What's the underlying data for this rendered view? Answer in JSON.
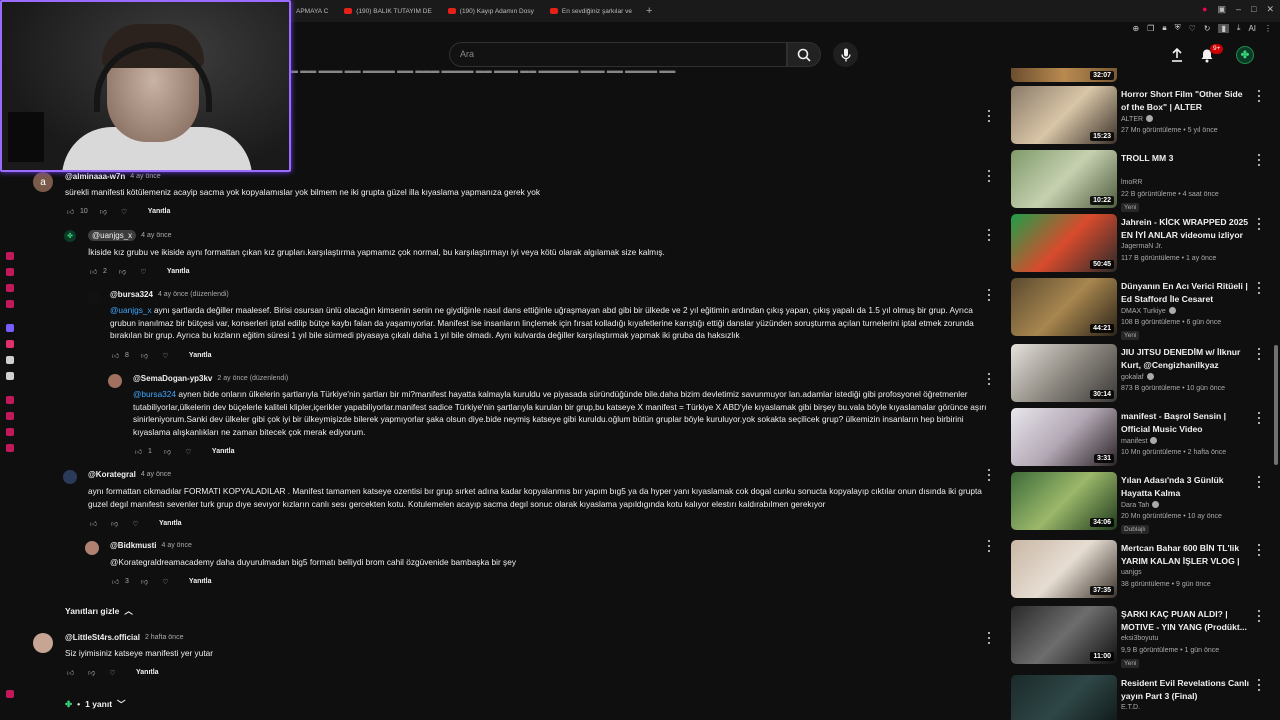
{
  "browser": {
    "tabs": [
      {
        "label": "APMAYA C"
      },
      {
        "label": "(190) BALIK TUTAYIM DE"
      },
      {
        "label": "(190) Kayıp Adamın Dosy"
      },
      {
        "label": "En sevdiğiniz şarkılar ve"
      }
    ],
    "new_tab": "+",
    "extension_label": "AI"
  },
  "header": {
    "search_placeholder": "Ara",
    "notification_count": "9+"
  },
  "comments": [
    {
      "author": "@alminaaa-w7n",
      "time": "4 ay önce",
      "avatar_letter": "a",
      "avatar_color": "#7a5a4a",
      "text": "sürekli manifesti kötülemeniz acayip sacma yok kopyalamıslar yok bilmem ne iki grupta güzel illa kıyaslama yapmanıza gerek yok",
      "likes": "10",
      "reply_label": "Yanıtla"
    },
    {
      "author": "@uanjgs_x",
      "time": "4 ay önce",
      "text": "İkiside kız grubu ve ikiside aynı formattan çıkan kız grupları.karşılaştırma yapmamız çok normal, bu karşılaştırmayı iyi veya kötü olarak algılamak size kalmış.",
      "likes": "2",
      "reply_label": "Yanıtla"
    },
    {
      "author": "@bursa324",
      "time": "4 ay önce (düzenlendi)",
      "mention": "@uanjgs_x",
      "text": " aynı şartlarda değiller maalesef. Birisi osursan ünlü olacağın kimsenin senin ne giydiğinle nasıl dans ettiğinle uğraşmayan abd gibi bir ülkede ve 2 yıl eğitimin ardından çıkış yapan, çıkış yapalı da 1.5 yıl olmuş bir grup. Ayrıca grubun inanılmaz bir bütçesi var, konserleri iptal edilip bütçe kaybı falan da yaşamıyorlar. Manifest ise insanların linçlemek için fırsat kolladığı kıyafetlerine karıştığı ettiği danslar yüzünden soruşturma açılan turnelerini iptal etmek zorunda bırakılan bir grup. Ayrıca bu kızların eğitim süresi 1 yıl bile sürmedi piyasaya çıkalı daha 1 yıl bile olmadı. Aynı kulvarda değiller karşılaştırmak yapmak iki gruba da haksızlık",
      "likes": "8",
      "reply_label": "Yanıtla"
    },
    {
      "author": "@SemaDogan-yp3kv",
      "time": "2 ay önce (düzenlendi)",
      "mention": "@bursa324",
      "text": " aynen  bide  onların ülkelerin şartlarıyla Türkiye'nin şartları bir mi?manifest hayatta kalmayla kuruldu ve piyasada süründüğünde bile.daha bizim devletimiz savunmuyor lan.adamlar istediği gibi profosyonel öğretmenler tutabiliyorlar,ülkelerin dev  büçelerle kaliteli klipler,içerikler yapabiliyorlar.manifest sadice Türkiye'nin şartlarıyla kurulan bir grup,bu katseye X manifest = Türkiye X ABD'yle kıyaslamak gibi birşey bu.vala böyle kıyaslamalar görünce aşırı sinirleniyorum.Sanki dev ülkeler gibi çok iyi bir ülkeymişizde bilerek yapmıyorlar şaka olsun diye.bide neymiş katseye gibi kuruldu.oğlum bütün gruplar böyle kuruluyor.yok sokakta seçilicek grup? ülkemizin insanların hep birbirini kıyaslama alışkanlıkları ne zaman bitecek çok merak ediyorum.",
      "likes": "1",
      "reply_label": "Yanıtla"
    },
    {
      "author": "@Korategral",
      "time": "4 ay önce",
      "text": "aynı formattan cıkmadılar FORMATI KOPYALADILAR . Manifest tamamen katseye ozentisi bır grup sırket adına kadar kopyalanmıs bır yapım bıg5 ya da hyper yanı kıyaslamak cok dogal cunku sonucta kopyalayıp cıktılar onun dısında iki grupta guzel degıl manıfestı sevenler turk grup dıye sevıyor kızların canlı sesı gercekten kotu. Kotulemelen acayıp sacma degıl sonuc olarak kıyaslama yapıldıgında kotu kalıyor elestırı kaldırabılmen gerekıyor",
      "likes": "",
      "reply_label": "Yanıtla"
    },
    {
      "author": "@Bidkmusti",
      "time": "4 ay önce",
      "text": "@Korategraldreamacademy daha duyurulmadan big5 formatı belliydi brom cahil özgüvenide bambaşka bir şey",
      "likes": "3",
      "reply_label": "Yanıtla"
    },
    {
      "author": "@LittleSt4rs.official",
      "time": "2 hafta önce",
      "text": "Siz iyimisiniz katseye manifesti yer yutar",
      "likes": "",
      "reply_label": "Yanıtla"
    }
  ],
  "hide_replies_label": "Yanıtları gizle",
  "one_reply_label": "1 yanıt",
  "sidebar": {
    "top_duration": "32:07",
    "videos": [
      {
        "title": "Horror Short Film \"Other Side of the Box\" | ALTER",
        "channel": "ALTER",
        "verified": true,
        "meta": "27 Mn görüntüleme • 5 yıl önce",
        "duration": "15:23",
        "badge": "",
        "colors": [
          "#8a7a68",
          "#d9c6a8",
          "#3a3128"
        ]
      },
      {
        "title": "TROLL MM 3",
        "channel": "lmoRR",
        "verified": false,
        "meta": "22 B görüntüleme • 4 saat önce",
        "duration": "10:22",
        "badge": "Yeni",
        "colors": [
          "#7f9a6a",
          "#c6d1b0",
          "#4f5c3e"
        ]
      },
      {
        "title": "Jahrein - KİCK WRAPPED 2025 EN İYİ ANLAR videomu izliyor",
        "channel": "JagermaN Jr.",
        "verified": false,
        "meta": "117 B görüntüleme • 1 ay önce",
        "duration": "50:45",
        "badge": "",
        "colors": [
          "#1e9f4a",
          "#d84b2d",
          "#2a2a2a"
        ]
      },
      {
        "title": "Dünyanın En Acı Verici Ritüeli | Ed Stafford İle Cesaret İsteyen...",
        "channel": "DMAX Turkiye",
        "verified": true,
        "meta": "108 B görüntüleme • 6 gün önce",
        "duration": "44:21",
        "badge": "Yeni",
        "colors": [
          "#5a4a30",
          "#a8864f",
          "#2c2418"
        ]
      },
      {
        "title": "JIU JITSU DENEDİM w/ İlknur Kurt, @Cengizhanilkyaz",
        "channel": "gokalaf",
        "verified": true,
        "meta": "873 B görüntüleme • 10 gün önce",
        "duration": "30:14",
        "badge": "",
        "colors": [
          "#e5e2dc",
          "#8f8a82",
          "#3a3836"
        ]
      },
      {
        "title": "manifest - Başrol Sensin | Official Music Video",
        "channel": "manifest",
        "verified": true,
        "meta": "10 Mn görüntüleme • 2 hafta önce",
        "duration": "3:31",
        "badge": "",
        "colors": [
          "#e8e6ec",
          "#b3a8b5",
          "#2b2226"
        ]
      },
      {
        "title": "Yılan Adası'nda 3 Günlük Hayatta Kalma",
        "channel": "Dara Tah",
        "verified": true,
        "meta": "20 Mn görüntüleme • 10 ay önce",
        "duration": "34:06",
        "badge": "Dublajlı",
        "colors": [
          "#3d6b3a",
          "#9bb86a",
          "#1f3a1d"
        ]
      },
      {
        "title": "Mertcan Bahar 600 BİN TL'lik YARIM KALAN İŞLER VLOG | ...",
        "channel": "uanjgs",
        "verified": false,
        "meta": "38 görüntüleme • 9 gün önce",
        "duration": "37:35",
        "badge": "",
        "colors": [
          "#c9b7a4",
          "#e6ddd2",
          "#3c332c"
        ]
      },
      {
        "title": "ŞARKI KAÇ PUAN ALDI? | MOTIVE  - YIN YANG (Prodükt...",
        "channel": "eksi3boyutu",
        "verified": false,
        "meta": "9,9 B görüntüleme • 1 gün önce",
        "duration": "11:00",
        "badge": "Yeni",
        "colors": [
          "#2a2a2a",
          "#6d6d6d",
          "#111111"
        ]
      },
      {
        "title": "Resident Evil Revelations  Canlı yayın  Part 3 (Final)",
        "channel": "E.T.D.",
        "verified": false,
        "meta": "",
        "duration": "",
        "badge": "",
        "colors": [
          "#1b2a2a",
          "#2f4747",
          "#0c1414"
        ]
      }
    ]
  }
}
